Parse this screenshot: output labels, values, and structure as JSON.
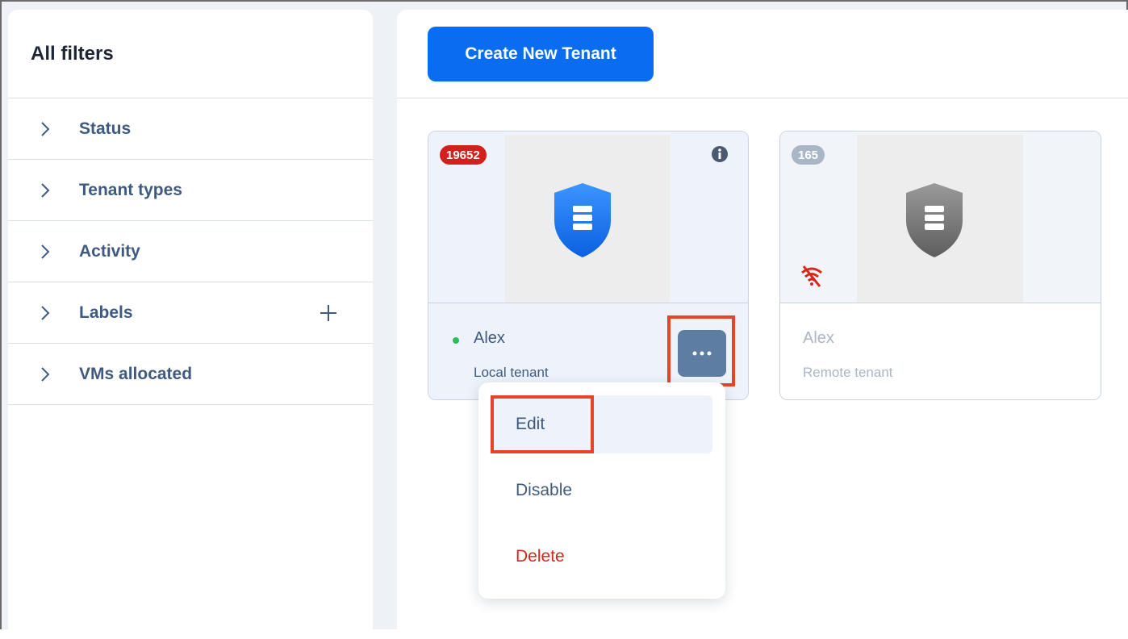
{
  "sidebar": {
    "title": "All filters",
    "filters": [
      {
        "label": "Status",
        "icon": "chevron-right-icon"
      },
      {
        "label": "Tenant types",
        "icon": "chevron-right-icon"
      },
      {
        "label": "Activity",
        "icon": "chevron-right-icon"
      },
      {
        "label": "Labels",
        "icon": "chevron-right-icon",
        "action_icon": "plus-icon"
      },
      {
        "label": "VMs allocated",
        "icon": "chevron-right-icon"
      }
    ]
  },
  "toolbar": {
    "create_label": "Create New Tenant"
  },
  "tenants": [
    {
      "count": "19652",
      "count_color": "#d4201d",
      "name": "Alex",
      "type": "Local tenant",
      "status": "online",
      "shield_color": "#1a78f0",
      "icons": [
        "info-icon",
        "shield-icon",
        "more-icon"
      ]
    },
    {
      "count": "165",
      "count_color": "#a9b6c6",
      "name": "Alex",
      "type": "Remote tenant",
      "status": "disconnected",
      "shield_color": "#7a7a7a",
      "icons": [
        "wifi-off-icon",
        "shield-icon"
      ]
    }
  ],
  "menu": {
    "items": [
      {
        "label": "Edit",
        "color": "#3e5a7e"
      },
      {
        "label": "Disable",
        "color": "#3e5a7e"
      },
      {
        "label": "Delete",
        "color": "#d9261c"
      }
    ]
  },
  "colors": {
    "accent": "#0a6cf0",
    "highlight": "#e8432a",
    "text_primary": "#3e5a7e"
  }
}
